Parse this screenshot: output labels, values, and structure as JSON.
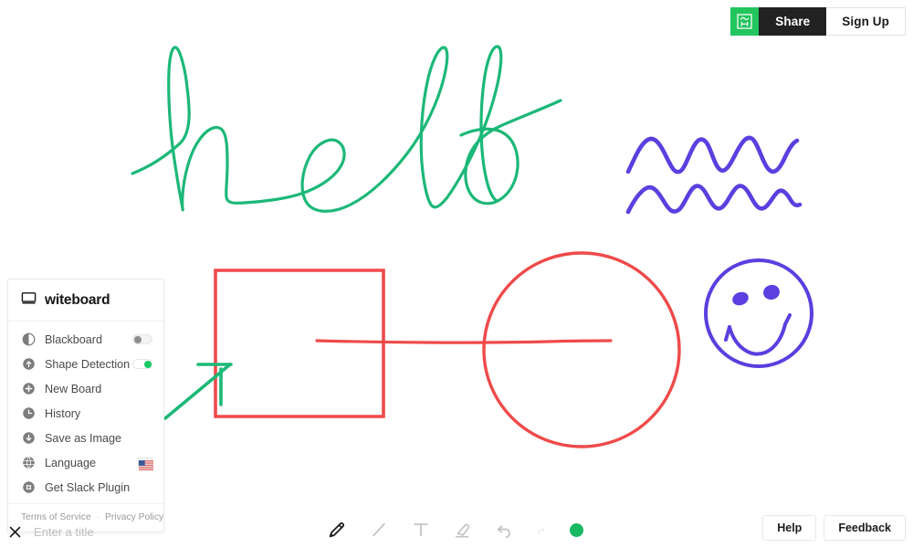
{
  "app": {
    "name": "witeboard",
    "logo_icon": "whiteboard-icon"
  },
  "topbar": {
    "brand_icon": "witeboard-mark-icon",
    "brand_chip_color": "#22c55e",
    "share_label": "Share",
    "signup_label": "Sign Up"
  },
  "sidebar": {
    "title": "witeboard",
    "items": [
      {
        "label": "Blackboard",
        "icon": "contrast-icon",
        "control": "toggle",
        "state": "off"
      },
      {
        "label": "Shape Detection",
        "icon": "arrow-up-circle-icon",
        "control": "toggle",
        "state": "on"
      },
      {
        "label": "New Board",
        "icon": "plus-circle-icon",
        "control": "none",
        "state": ""
      },
      {
        "label": "History",
        "icon": "clock-icon",
        "control": "none",
        "state": ""
      },
      {
        "label": "Save as Image",
        "icon": "download-circle-icon",
        "control": "none",
        "state": ""
      },
      {
        "label": "Language",
        "icon": "globe-icon",
        "control": "flag",
        "state": "us"
      },
      {
        "label": "Get Slack Plugin",
        "icon": "slack-icon",
        "control": "none",
        "state": ""
      }
    ],
    "footer": {
      "terms_label": "Terms of Service",
      "separator": "·",
      "privacy_label": "Privacy Policy"
    }
  },
  "bottombar": {
    "close_icon": "close-x-icon",
    "title_value": "",
    "title_placeholder": "Enter a title",
    "tools": [
      {
        "name": "pencil-tool",
        "icon": "pencil-icon",
        "active": true
      },
      {
        "name": "line-tool",
        "icon": "line-icon",
        "active": false
      },
      {
        "name": "text-tool",
        "icon": "text-t-icon",
        "active": false
      },
      {
        "name": "eraser-tool",
        "icon": "eraser-icon",
        "active": false
      },
      {
        "name": "undo-button",
        "icon": "undo-arrow-icon",
        "active": false
      },
      {
        "name": "redo-button",
        "icon": "redo-arrow-icon",
        "active": false
      }
    ],
    "selected_color": "#16b861",
    "help_label": "Help",
    "feedback_label": "Feedback"
  },
  "canvas": {
    "background": "#ffffff",
    "strokes": [
      {
        "name": "hello-handwriting",
        "color": "#1cb877",
        "width": 3.2,
        "kind": "freehand-text",
        "text": "hello"
      },
      {
        "name": "purple-squiggle-top",
        "color": "#5b3fe0",
        "width": 4.5,
        "kind": "wave"
      },
      {
        "name": "purple-squiggle-bottom",
        "color": "#5b3fe0",
        "width": 4.5,
        "kind": "wave"
      },
      {
        "name": "red-rectangle",
        "color": "#ef4a4a",
        "width": 3.6,
        "kind": "rectangle"
      },
      {
        "name": "red-horizontal-line",
        "color": "#ef4a4a",
        "width": 3.2,
        "kind": "line"
      },
      {
        "name": "red-circle",
        "color": "#ef4a4a",
        "width": 3.4,
        "kind": "circle"
      },
      {
        "name": "green-arrow",
        "color": "#1cb877",
        "width": 3.4,
        "kind": "arrow"
      },
      {
        "name": "purple-smiley-face",
        "color": "#5b3fe0",
        "width": 4.0,
        "kind": "smiley"
      }
    ]
  }
}
